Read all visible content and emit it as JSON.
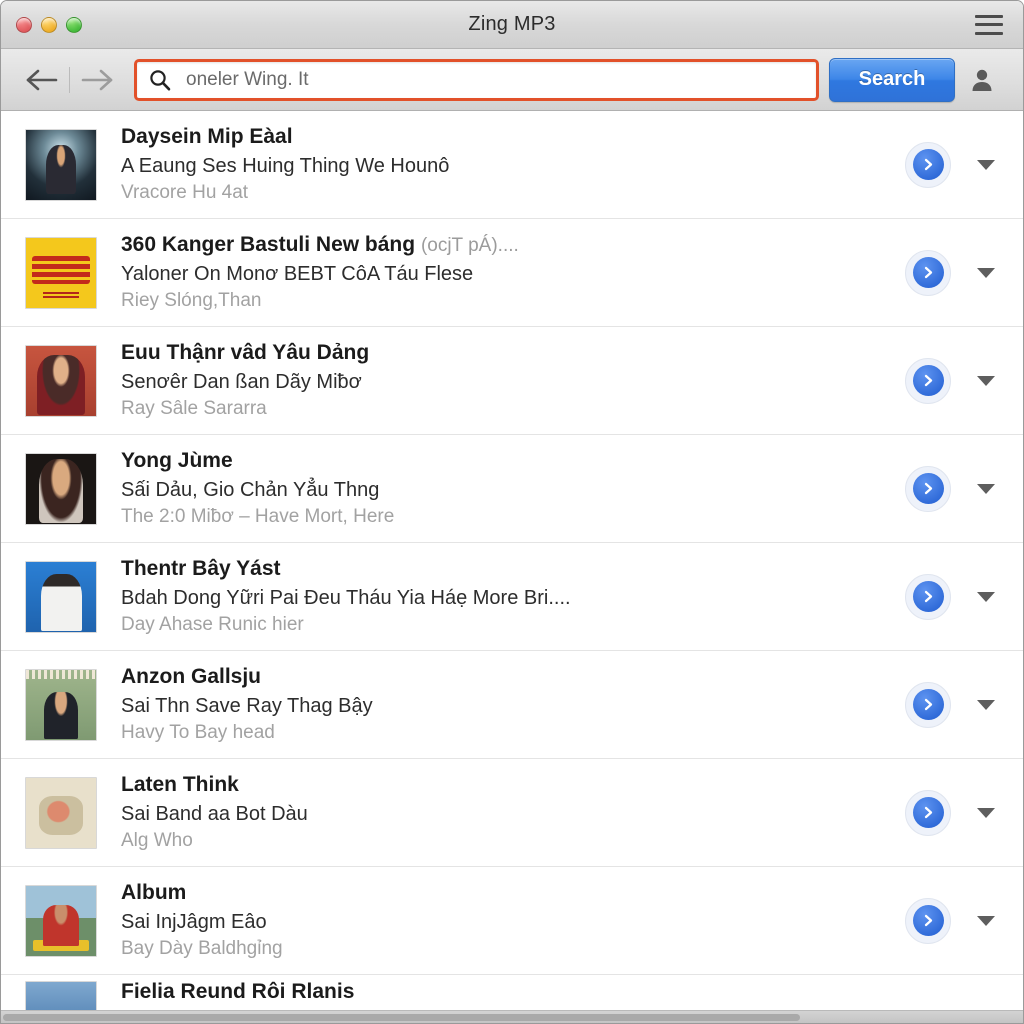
{
  "window": {
    "title": "Zing MP3",
    "traffic_lights": [
      "close",
      "minimize",
      "maximize"
    ],
    "menu_icon": "hamburger-icon"
  },
  "toolbar": {
    "back_icon": "arrow-left-icon",
    "forward_icon": "arrow-right-icon",
    "search_icon": "search-icon",
    "search_value": "oneler Wing. It",
    "search_placeholder": "oneler Wing. It",
    "search_button_label": "Search",
    "account_icon": "user-account-icon",
    "search_highlight_color": "#e2512a",
    "search_button_color": "#3d86e8"
  },
  "results": {
    "play_icon": "chevron-right-circle-icon",
    "dropdown_icon": "caret-down-icon",
    "items": [
      {
        "title": "Daysein Mip Eàal",
        "title_suffix": "",
        "subtitle": "A Eaung Ses Huing Thing We Hounô",
        "extra": "Vracore Hu 4at",
        "art": "art-a"
      },
      {
        "title": "360 Kanger Bastuli New báng",
        "title_suffix": "(ocjT pÁ)....",
        "subtitle": "Yaloner On Monơ BEBT CôA Táu Flese",
        "extra": "Riey Slóng,Than",
        "art": "art-b"
      },
      {
        "title": "Euu Thậnr vâd Yâu Dảng",
        "title_suffix": "",
        "subtitle": "Senơêr Dan ßan Dãy Miƀơ",
        "extra": "Ray Sâle Sararra",
        "art": "art-c"
      },
      {
        "title": "Yong Jùme",
        "title_suffix": "",
        "subtitle": "Sấi Dảu, Gio Chản Yẳu Thng",
        "extra": "The 2:0 Miƀơ – Have Mort, Here",
        "art": "art-d"
      },
      {
        "title": "Thentr Bây Yást",
        "title_suffix": "",
        "subtitle": "Bdah Dong Yữri Pai Ðeu Tháu Yia Háẹ More Bri....",
        "extra": "Day Ahase Runic hier",
        "art": "art-e"
      },
      {
        "title": "Anzon Gallsju",
        "title_suffix": "",
        "subtitle": "Sai Thn Save Ray Thag Bậy",
        "extra": "Havy To Bay head",
        "art": "art-f"
      },
      {
        "title": "Laten Think",
        "title_suffix": "",
        "subtitle": "Sai Band aa Bot Dàu",
        "extra": "Alg Who",
        "art": "art-g"
      },
      {
        "title": "Album",
        "title_suffix": "",
        "subtitle": "Sai InjJâgm Eâo",
        "extra": "Bay Dày Baldhgỉng",
        "art": "art-h"
      },
      {
        "title": "Fielia Reund Rôi Rlanis",
        "title_suffix": "",
        "subtitle": "",
        "extra": "",
        "art": "art-i"
      }
    ]
  }
}
